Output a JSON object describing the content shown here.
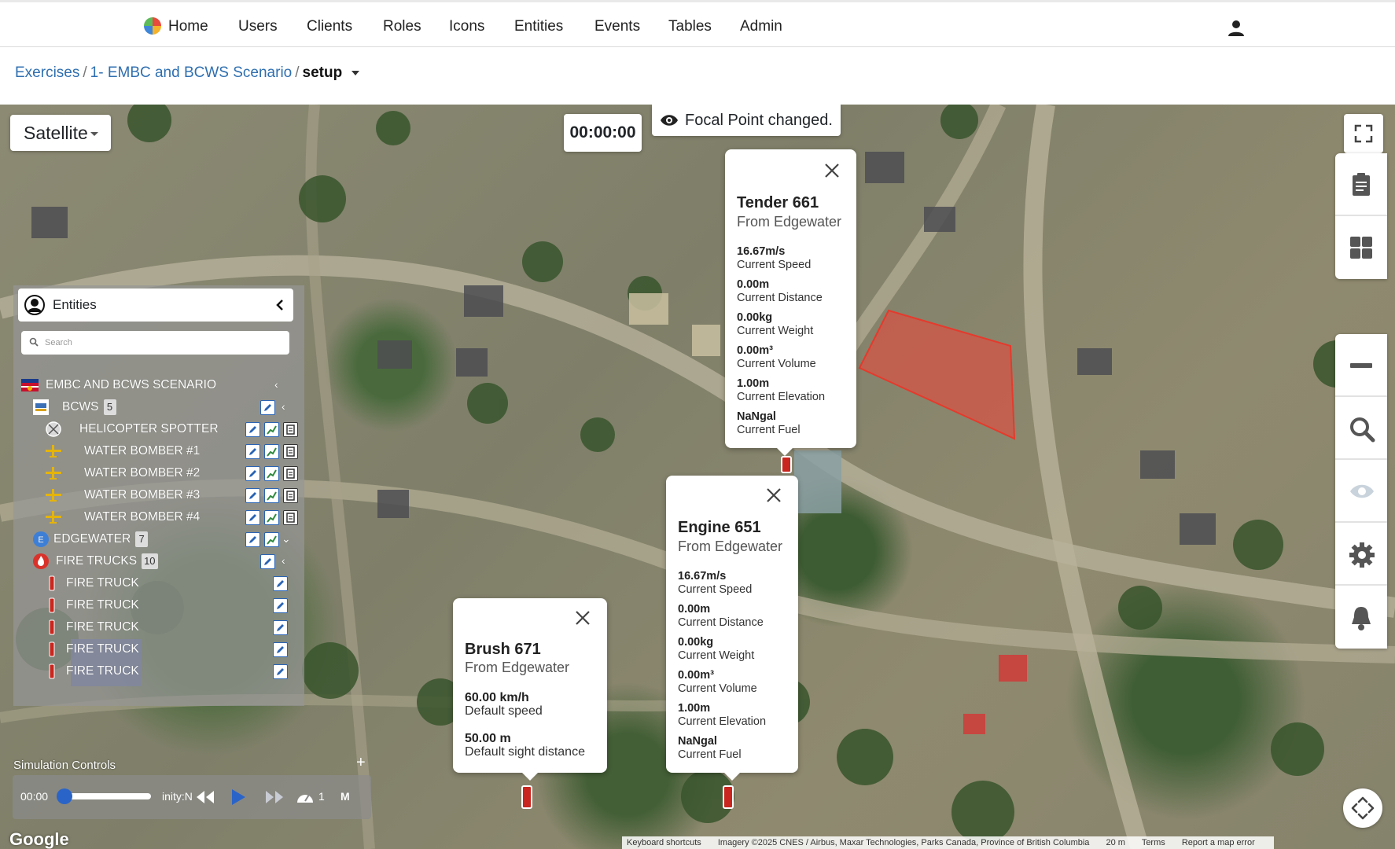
{
  "nav": {
    "home": "Home",
    "items": [
      "Users",
      "Clients",
      "Roles",
      "Icons",
      "Entities",
      "Events",
      "Tables",
      "Admin"
    ]
  },
  "breadcrumb": {
    "exercises": "Exercises",
    "scenario": "1- EMBC and BCWS Scenario",
    "current": "setup"
  },
  "map": {
    "type": "Satellite",
    "timer": "00:00:00",
    "toast": "Focal Point changed.",
    "google": "Google",
    "attribution": {
      "shortcuts": "Keyboard shortcuts",
      "imagery": "Imagery ©2025 CNES / Airbus, Maxar Technologies, Parks Canada, Province of British Columbia",
      "scale": "20 m",
      "terms": "Terms",
      "report": "Report a map error"
    },
    "zone_color": "#e8483c"
  },
  "entities": {
    "title": "Entities",
    "search_placeholder": "Search",
    "rows": [
      {
        "label": "EMBC AND BCWS SCENARIO"
      },
      {
        "label": "BCWS",
        "badge": "5"
      },
      {
        "label": "HELICOPTER SPOTTER"
      },
      {
        "label": "WATER BOMBER #1"
      },
      {
        "label": "WATER BOMBER #2"
      },
      {
        "label": "WATER BOMBER #3"
      },
      {
        "label": "WATER BOMBER #4"
      },
      {
        "label": "EDGEWATER",
        "badge": "7"
      },
      {
        "label": "FIRE TRUCKS",
        "badge": "10"
      },
      {
        "label": "FIRE TRUCK"
      },
      {
        "label": "FIRE TRUCK"
      },
      {
        "label": "FIRE TRUCK"
      },
      {
        "label": "FIRE TRUCK"
      },
      {
        "label": "FIRE TRUCK"
      }
    ]
  },
  "sim": {
    "label": "Simulation Controls",
    "time": "00:00",
    "timezone": "inity:N",
    "speed": "1",
    "mode": "M"
  },
  "popups": {
    "tender": {
      "title": "Tender 661",
      "sub": "From Edgewater",
      "stats": [
        {
          "value": "16.67m/s",
          "label": "Current Speed"
        },
        {
          "value": "0.00m",
          "label": "Current Distance"
        },
        {
          "value": "0.00kg",
          "label": "Current Weight"
        },
        {
          "value": "0.00m³",
          "label": "Current Volume"
        },
        {
          "value": "1.00m",
          "label": "Current Elevation"
        },
        {
          "value": "NaNgal",
          "label": "Current Fuel"
        }
      ]
    },
    "engine": {
      "title": "Engine 651",
      "sub": "From Edgewater",
      "stats": [
        {
          "value": "16.67m/s",
          "label": "Current Speed"
        },
        {
          "value": "0.00m",
          "label": "Current Distance"
        },
        {
          "value": "0.00kg",
          "label": "Current Weight"
        },
        {
          "value": "0.00m³",
          "label": "Current Volume"
        },
        {
          "value": "1.00m",
          "label": "Current Elevation"
        },
        {
          "value": "NaNgal",
          "label": "Current Fuel"
        }
      ]
    },
    "brush": {
      "title": "Brush 671",
      "sub": "From Edgewater",
      "stats": [
        {
          "value": "60.00 km/h",
          "label": "Default speed"
        },
        {
          "value": "50.00 m",
          "label": "Default sight distance"
        }
      ]
    }
  }
}
